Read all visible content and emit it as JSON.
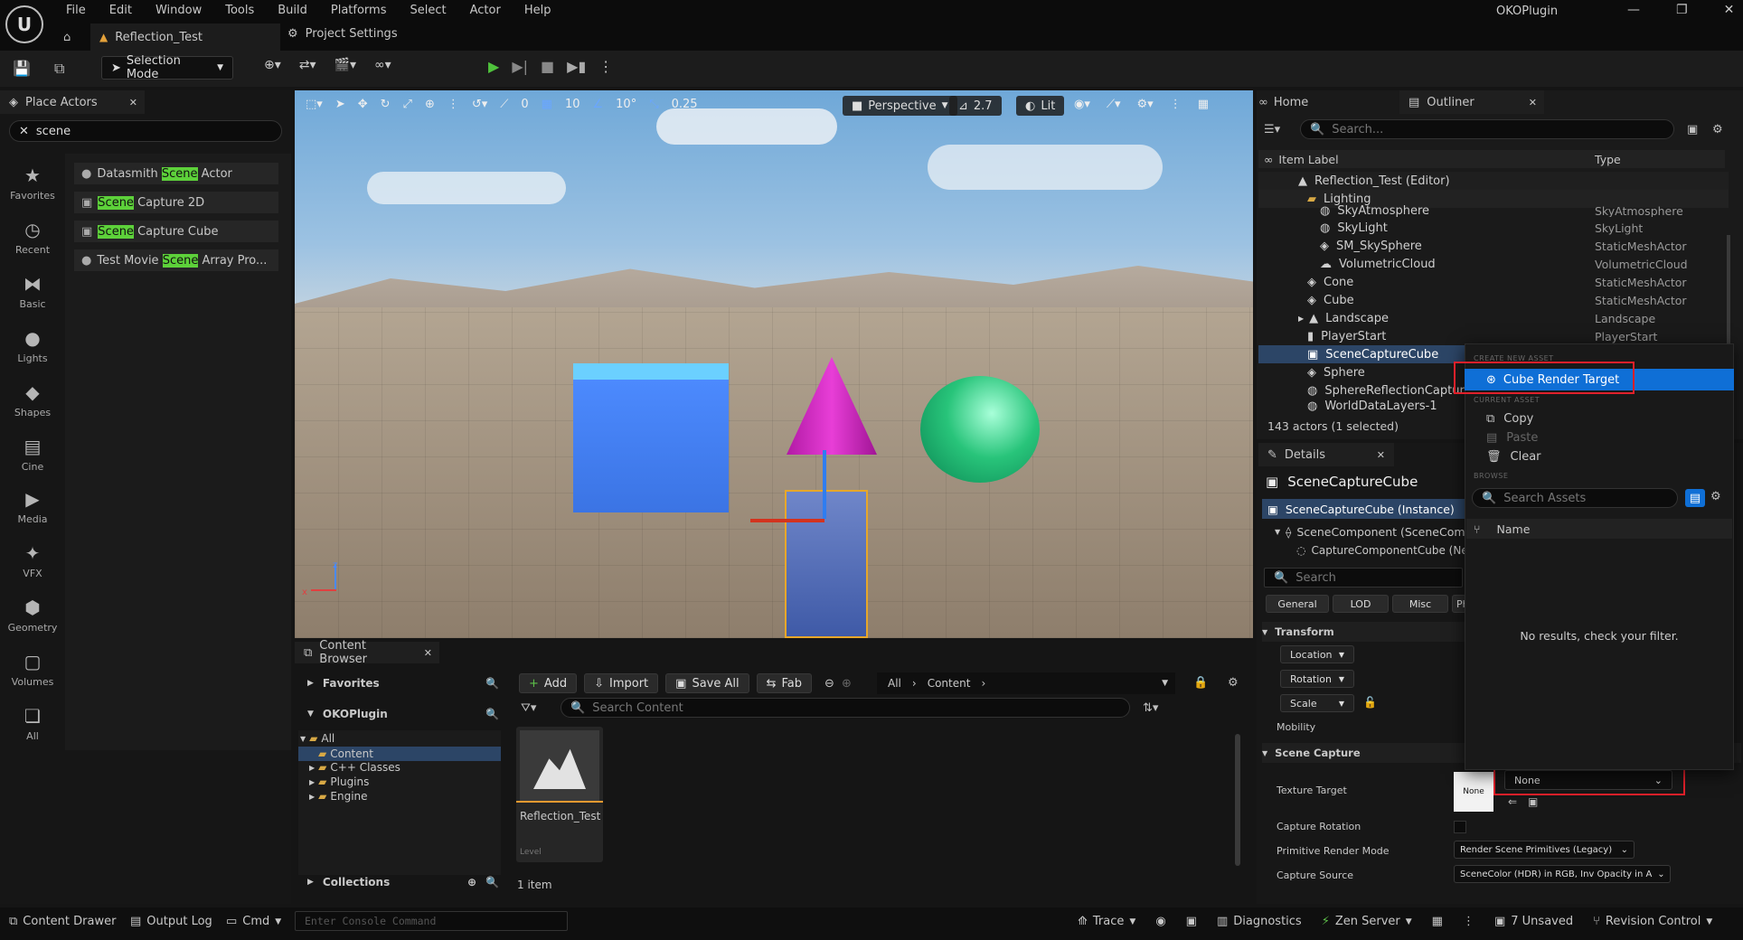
{
  "menu": {
    "items": [
      "File",
      "Edit",
      "Window",
      "Tools",
      "Build",
      "Platforms",
      "Select",
      "Actor",
      "Help"
    ],
    "project": "OKOPlugin"
  },
  "tabs": {
    "level": "Reflection_Test",
    "settings": "Project Settings"
  },
  "toolbar": {
    "mode": "Selection Mode"
  },
  "place_actors": {
    "title": "Place Actors",
    "search": "scene",
    "items": [
      {
        "pre": "Datasmith ",
        "hl": "Scene",
        "post": " Actor"
      },
      {
        "pre": "",
        "hl": "Scene",
        "post": " Capture 2D"
      },
      {
        "pre": "",
        "hl": "Scene",
        "post": " Capture Cube"
      },
      {
        "pre": "Test Movie ",
        "hl": "Scene",
        "post": " Array Pro..."
      }
    ],
    "categories": [
      "Favorites",
      "Recent",
      "Basic",
      "Lights",
      "Shapes",
      "Cine",
      "Media",
      "VFX",
      "Geometry",
      "Volumes",
      "All"
    ]
  },
  "viewport": {
    "move_snap": "0",
    "grid": "10",
    "rot_snap": "10°",
    "scale_snap": "0.25",
    "perspective": "Perspective",
    "camera_speed": "2.7",
    "lit": "Lit"
  },
  "outliner": {
    "home_tab": "Home",
    "title": "Outliner",
    "search_placeholder": "Search...",
    "col_label": "Item Label",
    "col_type": "Type",
    "rows": [
      {
        "label": "Reflection_Test (Editor)",
        "type": "",
        "indent": 0
      },
      {
        "label": "Lighting",
        "type": "",
        "indent": 1
      },
      {
        "label": "SkyAtmosphere",
        "type": "SkyAtmosphere",
        "indent": 2
      },
      {
        "label": "SkyLight",
        "type": "SkyLight",
        "indent": 2
      },
      {
        "label": "SM_SkySphere",
        "type": "StaticMeshActor",
        "indent": 2
      },
      {
        "label": "VolumetricCloud",
        "type": "VolumetricCloud",
        "indent": 2
      },
      {
        "label": "Cone",
        "type": "StaticMeshActor",
        "indent": 1
      },
      {
        "label": "Cube",
        "type": "StaticMeshActor",
        "indent": 1
      },
      {
        "label": "Landscape",
        "type": "Landscape",
        "indent": 1
      },
      {
        "label": "PlayerStart",
        "type": "PlayerStart",
        "indent": 1
      },
      {
        "label": "SceneCaptureCube",
        "type": "",
        "indent": 1
      },
      {
        "label": "Sphere",
        "type": "",
        "indent": 1
      },
      {
        "label": "SphereReflectionCapture",
        "type": "",
        "indent": 1
      },
      {
        "label": "WorldDataLayers-1",
        "type": "",
        "indent": 1
      }
    ],
    "status": "143 actors (1 selected)"
  },
  "details": {
    "title": "Details",
    "object": "SceneCaptureCube",
    "instance": "SceneCaptureCube (Instance)",
    "component": "SceneComponent (SceneCom",
    "capture_component": "CaptureComponentCube (Ne",
    "search_placeholder": "Search",
    "filters": [
      "General",
      "LOD",
      "Misc",
      "Ph"
    ],
    "transform": "Transform",
    "location": "Location",
    "rotation": "Rotation",
    "scale": "Scale",
    "mobility": "Mobility",
    "scene_capture": "Scene Capture",
    "texture_target": "Texture Target",
    "thumb_none": "None",
    "target_value": "None",
    "capture_rotation": "Capture Rotation",
    "primitive_render_mode": "Primitive Render Mode",
    "primitive_value": "Render Scene Primitives (Legacy)",
    "capture_source": "Capture Source",
    "capture_source_value": "SceneColor (HDR) in RGB, Inv Opacity in A"
  },
  "popup": {
    "create_header": "CREATE NEW ASSET",
    "create_item": "Cube Render Target",
    "current_header": "CURRENT ASSET",
    "copy": "Copy",
    "paste": "Paste",
    "clear": "Clear",
    "browse_header": "BROWSE",
    "search_placeholder": "Search Assets",
    "col_name": "Name",
    "empty": "No results, check your filter."
  },
  "content_browser": {
    "title": "Content Browser",
    "favorites": "Favorites",
    "plugin": "OKOPlugin",
    "tree": [
      "All",
      "Content",
      "C++ Classes",
      "Plugins",
      "Engine"
    ],
    "collections": "Collections",
    "add": "Add",
    "import": "Import",
    "save_all": "Save All",
    "fab": "Fab",
    "path_all": "All",
    "path_content": "Content",
    "search_placeholder": "Search Content",
    "asset_name": "Reflection_Test",
    "asset_type": "Level",
    "count": "1 item"
  },
  "statusbar": {
    "content_drawer": "Content Drawer",
    "output_log": "Output Log",
    "cmd": "Cmd",
    "console_placeholder": "Enter Console Command",
    "trace": "Trace",
    "diagnostics": "Diagnostics",
    "zen": "Zen Server",
    "unsaved": "7 Unsaved",
    "revision": "Revision Control"
  },
  "colors": {
    "accent": "#0f6fd6",
    "highlight": "#5dd13a",
    "annotation": "#e0202a"
  }
}
